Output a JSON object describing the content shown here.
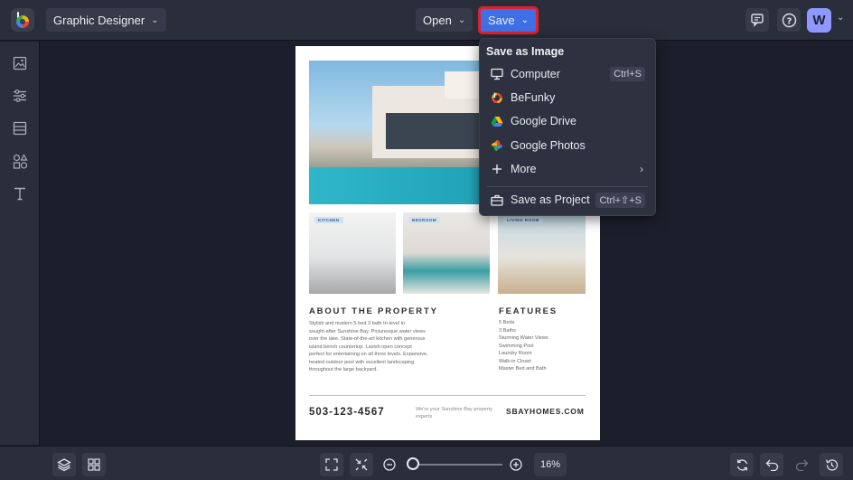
{
  "topbar": {
    "project_label": "Graphic Designer",
    "open_label": "Open",
    "save_label": "Save",
    "avatar_initial": "W"
  },
  "save_menu": {
    "header": "Save as Image",
    "items": [
      {
        "label": "Computer",
        "shortcut": "Ctrl+S",
        "icon": "monitor-icon"
      },
      {
        "label": "BeFunky",
        "icon": "befunky-icon"
      },
      {
        "label": "Google Drive",
        "icon": "google-drive-icon"
      },
      {
        "label": "Google Photos",
        "icon": "google-photos-icon"
      },
      {
        "label": "More",
        "icon": "plus-icon"
      },
      {
        "label": "Save as Project",
        "shortcut": "Ctrl+⇧+S",
        "icon": "briefcase-icon"
      }
    ]
  },
  "sidebar": {
    "icons": [
      "image-icon",
      "sliders-icon",
      "layout-icon",
      "shapes-icon",
      "text-icon"
    ]
  },
  "document": {
    "room_tags": [
      "KITCHEN",
      "BEDROOM",
      "LIVING ROOM"
    ],
    "about_title": "ABOUT THE PROPERTY",
    "about_lines": [
      "Stylish and modern 5 bed 3 bath tri-level in",
      "sought-after Sunshine Bay. Picturesque water views",
      "over the lake. State-of-the-art kitchen with generous",
      "island bench countertop. Lavish open concept",
      "perfect for entertaining on all three levels. Expansive,",
      "heated outdoor pool with excellent landscaping",
      "throughout the large backyard."
    ],
    "features_title": "FEATURES",
    "features": [
      "5 Beds",
      "3 Baths",
      "Stunning Water Views",
      "Swimming Pool",
      "Laundry Room",
      "Walk-in Closet",
      "Master Bed and Bath"
    ],
    "phone": "503-123-4567",
    "tagline": "We're your Sunshine Bay property experts",
    "website": "SBAYHOMES.COM"
  },
  "zoom": {
    "value": "16%",
    "level": 0.06
  },
  "colors": {
    "accent": "#3f6fe6",
    "highlight": "#e0202b",
    "avatar": "#8e98ff"
  }
}
